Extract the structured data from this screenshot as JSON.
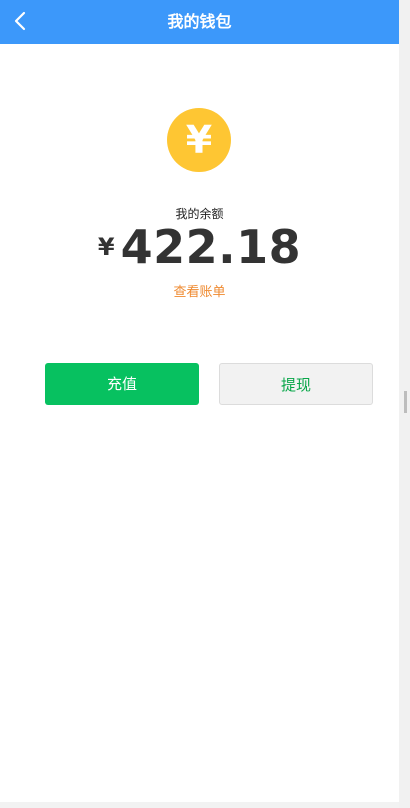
{
  "navbar": {
    "title": "我的钱包",
    "back_icon": "chevron-left-icon"
  },
  "wallet": {
    "coin_icon": "yuan-coin-icon",
    "coin_glyph": "¥",
    "balance_label": "我的余额",
    "currency_symbol": "¥",
    "amount": "422.18",
    "bill_link": "查看账单"
  },
  "actions": {
    "recharge_label": "充值",
    "withdraw_label": "提现"
  },
  "colors": {
    "navbar": "#3c98fa",
    "coin": "#fec633",
    "bill_link": "#ef8a30",
    "recharge": "#07c160",
    "withdraw_text": "#07a648"
  }
}
